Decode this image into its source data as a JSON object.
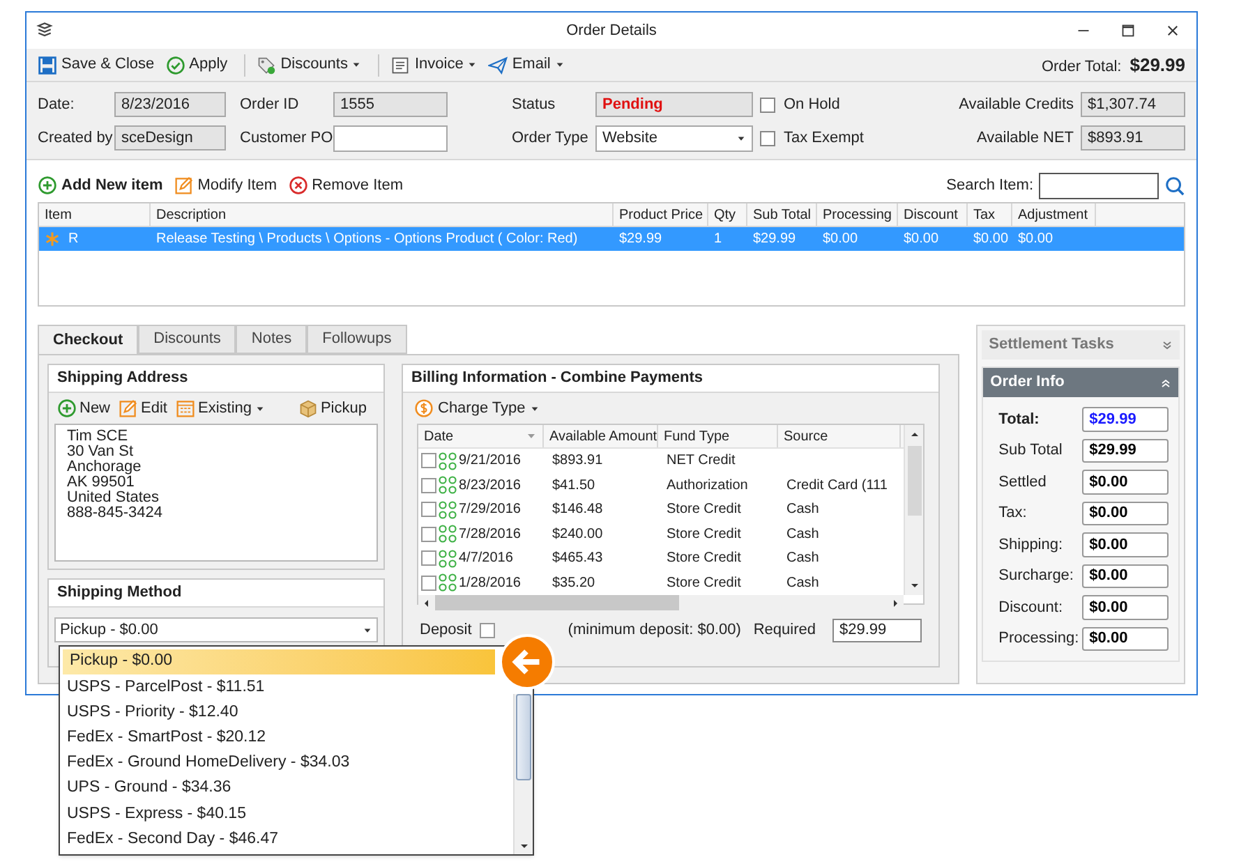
{
  "window": {
    "title": "Order Details"
  },
  "toolbar": [
    {
      "kind": "save",
      "label": "Save & Close",
      "menu": false
    },
    {
      "kind": "apply",
      "label": "Apply",
      "menu": false
    },
    {
      "kind": "discounts",
      "label": "Discounts",
      "menu": true
    },
    {
      "kind": "invoice",
      "label": "Invoice",
      "menu": true
    },
    {
      "kind": "email",
      "label": "Email",
      "menu": true
    }
  ],
  "order_total": {
    "label": "Order Total:",
    "value": "$29.99"
  },
  "header": [
    [
      {
        "kind": "readonly",
        "label": "Date:",
        "value": "8/23/2016"
      },
      {
        "kind": "readonly",
        "label": "Order ID",
        "value": "1555"
      },
      {
        "kind": "status",
        "label": "Status",
        "value": "Pending"
      },
      {
        "kind": "checkbox",
        "label": "On Hold",
        "checked": false
      },
      {
        "kind": "readonly",
        "label": "Available Credits",
        "value": "$1,307.74"
      }
    ],
    [
      {
        "kind": "readonly",
        "label": "Created by",
        "value": "sceDesign"
      },
      {
        "kind": "input",
        "label": "Customer PO"
      },
      {
        "kind": "select",
        "label": "Order Type",
        "value": "Website"
      },
      {
        "kind": "checkbox",
        "label": "Tax Exempt",
        "checked": false
      },
      {
        "kind": "readonly",
        "label": "Available NET",
        "value": "$893.91"
      }
    ]
  ],
  "item_actions": [
    {
      "kind": "add",
      "label": "Add New item"
    },
    {
      "kind": "modify",
      "label": "Modify Item"
    },
    {
      "kind": "remove",
      "label": "Remove Item"
    }
  ],
  "search": {
    "label": "Search Item:"
  },
  "items": {
    "columns": [
      "Item",
      "Description",
      "Product Price",
      "Qty",
      "Sub Total",
      "Processing",
      "Discount",
      "Tax",
      "Adjustment"
    ],
    "rows": [
      {
        "selected": true,
        "cells": [
          "R",
          "Release Testing \\ Products \\ Options - Options Product ( Color: Red)",
          "$29.99",
          "1",
          "$29.99",
          "$0.00",
          "$0.00",
          "$0.00",
          "$0.00"
        ]
      }
    ]
  },
  "tabs": [
    {
      "label": "Checkout",
      "selected": true
    },
    {
      "label": "Discounts",
      "selected": false
    },
    {
      "label": "Notes",
      "selected": false
    },
    {
      "label": "Followups",
      "selected": false
    }
  ],
  "shipping_address": {
    "title": "Shipping Address",
    "actions": [
      {
        "kind": "new",
        "label": "New",
        "menu": false
      },
      {
        "kind": "edit",
        "label": "Edit",
        "menu": false
      },
      {
        "kind": "existing",
        "label": "Existing",
        "menu": true
      },
      {
        "kind": "pickup",
        "label": "Pickup",
        "menu": false
      }
    ],
    "lines": [
      "Tim SCE",
      "30 Van St",
      "Anchorage",
      "AK 99501",
      "United States",
      "888-845-3424"
    ]
  },
  "shipping_method": {
    "title": "Shipping Method",
    "value": "Pickup - $0.00"
  },
  "billing": {
    "title": "Billing Information - Combine Payments",
    "charge_type": "Charge Type",
    "columns": [
      "Date",
      "Available Amount",
      "Fund Type",
      "Source"
    ],
    "rows": [
      {
        "checked": false,
        "cells": [
          "9/21/2016",
          "$893.91",
          "NET Credit",
          ""
        ]
      },
      {
        "checked": false,
        "cells": [
          "8/23/2016",
          "$41.50",
          "Authorization",
          "Credit Card  (111"
        ]
      },
      {
        "checked": false,
        "cells": [
          "7/29/2016",
          "$146.48",
          "Store Credit",
          "Cash"
        ]
      },
      {
        "checked": false,
        "cells": [
          "7/28/2016",
          "$240.00",
          "Store Credit",
          "Cash"
        ]
      },
      {
        "checked": false,
        "cells": [
          "4/7/2016",
          "$465.43",
          "Store Credit",
          "Cash"
        ]
      },
      {
        "checked": false,
        "cells": [
          "1/28/2016",
          "$35.20",
          "Store Credit",
          "Cash"
        ]
      }
    ],
    "deposit": {
      "label": "Deposit",
      "checked": false,
      "note": "(minimum deposit: $0.00)"
    },
    "required": {
      "label": "Required",
      "value": "$29.99"
    }
  },
  "settlement_tasks": {
    "title": "Settlement Tasks",
    "expanded": false
  },
  "order_info": {
    "title": "Order Info",
    "expanded": true,
    "rows": [
      {
        "kind": "total",
        "label": "Total:",
        "value": "$29.99"
      },
      {
        "kind": "normal",
        "label": "Sub Total",
        "value": "$29.99"
      },
      {
        "kind": "normal",
        "label": "Settled",
        "value": "$0.00"
      },
      {
        "kind": "normal",
        "label": "Tax:",
        "value": "$0.00"
      },
      {
        "kind": "normal",
        "label": "Shipping:",
        "value": "$0.00"
      },
      {
        "kind": "normal",
        "label": "Surcharge:",
        "value": "$0.00"
      },
      {
        "kind": "normal",
        "label": "Discount:",
        "value": "$0.00"
      },
      {
        "kind": "normal",
        "label": "Processing:",
        "value": "$0.00"
      }
    ]
  },
  "shipping_options": [
    {
      "label": "Pickup - $0.00",
      "selected": true
    },
    {
      "label": "USPS - ParcelPost - $11.51",
      "selected": false
    },
    {
      "label": "USPS - Priority - $12.40",
      "selected": false
    },
    {
      "label": "FedEx - SmartPost - $20.12",
      "selected": false
    },
    {
      "label": "FedEx - Ground HomeDelivery - $34.03",
      "selected": false
    },
    {
      "label": "UPS - Ground - $34.36",
      "selected": false
    },
    {
      "label": "USPS - Express - $40.15",
      "selected": false
    },
    {
      "label": "FedEx - Second Day - $46.47",
      "selected": false
    }
  ]
}
